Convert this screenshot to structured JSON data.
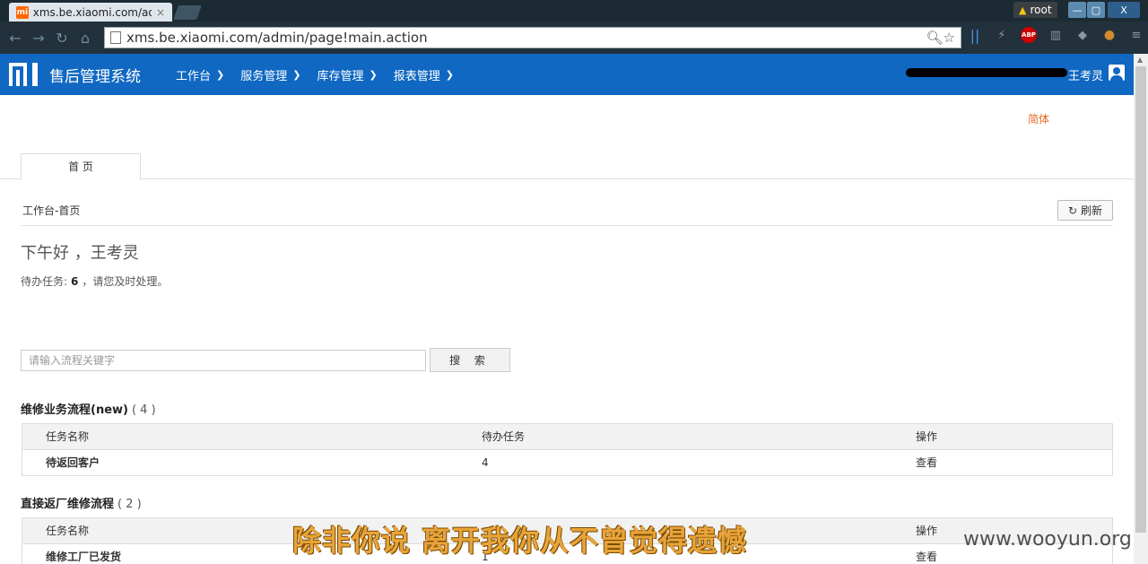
{
  "browser": {
    "tab_title": "xms.be.xiaomi.com/adn",
    "tab_close": "×",
    "favicon_text": "mi",
    "url": "xms.be.xiaomi.com/admin/page!main.action",
    "user_badge": "root",
    "win_min": "—",
    "win_max": "▢",
    "win_close": "X",
    "ext_abp": "ABP"
  },
  "header": {
    "app_name": "售后管理系统",
    "menu": [
      {
        "label": "工作台"
      },
      {
        "label": "服务管理"
      },
      {
        "label": "库存管理"
      },
      {
        "label": "报表管理"
      }
    ],
    "user_name": "王考灵"
  },
  "page": {
    "lang_switch": "简体",
    "tab_home": "首 页",
    "breadcrumb": "工作台-首页",
    "refresh_label": "刷新",
    "greeting": "下午好 ，王考灵",
    "todo_prefix": "待办任务:",
    "todo_count": "6",
    "todo_suffix": "，请您及时处理。",
    "search_placeholder": "请输入流程关键字",
    "search_button": "搜 索"
  },
  "sections": [
    {
      "title": "维修业务流程(new)",
      "count": "( 4 )",
      "columns": [
        "任务名称",
        "待办任务",
        "操作"
      ],
      "rows": [
        {
          "name": "待返回客户",
          "todo": "4",
          "action": "查看"
        }
      ]
    },
    {
      "title": "直接返厂维修流程",
      "count": "( 2 )",
      "columns": [
        "任务名称",
        "",
        "操作"
      ],
      "rows": [
        {
          "name": "维修工厂已发货",
          "todo": "1",
          "action": "查看"
        }
      ]
    }
  ],
  "overlay": {
    "subtitle": "除非你说 离开我你从不曾觉得遗憾",
    "watermark": "www.wooyun.org"
  },
  "colors": {
    "header_blue": "#1068c2",
    "lang_orange": "#e36a1d",
    "subtitle_gold": "#e8a43a"
  }
}
